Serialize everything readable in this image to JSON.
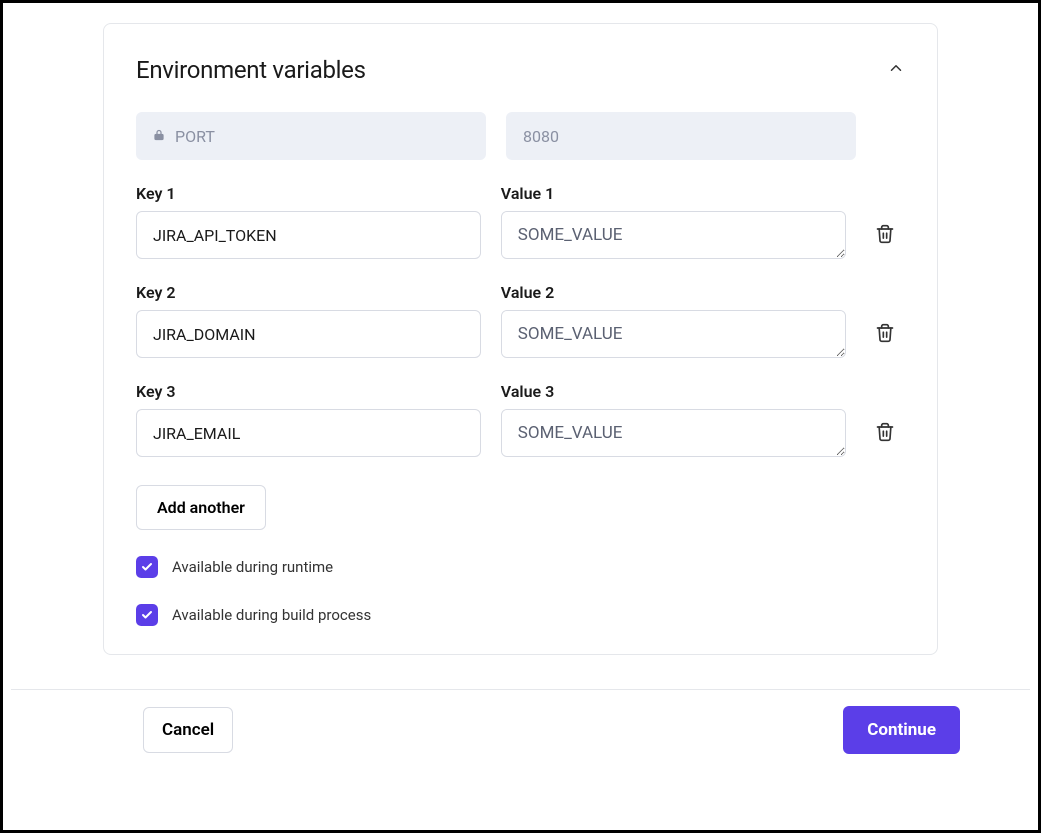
{
  "card": {
    "title": "Environment variables",
    "locked": {
      "key": "PORT",
      "value": "8080"
    },
    "rows": [
      {
        "key_label": "Key 1",
        "key": "JIRA_API_TOKEN",
        "value_label": "Value 1",
        "value": "SOME_VALUE"
      },
      {
        "key_label": "Key 2",
        "key": "JIRA_DOMAIN",
        "value_label": "Value 2",
        "value": "SOME_VALUE"
      },
      {
        "key_label": "Key 3",
        "key": "JIRA_EMAIL",
        "value_label": "Value 3",
        "value": "SOME_VALUE"
      }
    ],
    "add_label": "Add another",
    "checkboxes": [
      {
        "label": "Available during runtime",
        "checked": true
      },
      {
        "label": "Available during build process",
        "checked": true
      }
    ]
  },
  "footer": {
    "cancel": "Cancel",
    "continue": "Continue"
  },
  "colors": {
    "accent": "#5b3ee8"
  }
}
